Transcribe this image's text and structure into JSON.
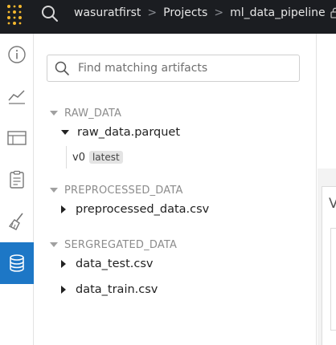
{
  "breadcrumb": {
    "user": "wasuratfirst",
    "section": "Projects",
    "project": "ml_data_pipeline",
    "separator": ">"
  },
  "sidebar": {
    "items": [
      {
        "icon": "info-icon"
      },
      {
        "icon": "line-chart-icon"
      },
      {
        "icon": "table-icon"
      },
      {
        "icon": "clipboard-icon"
      },
      {
        "icon": "broom-icon"
      },
      {
        "icon": "database-icon",
        "active": true
      }
    ]
  },
  "search": {
    "placeholder": "Find matching artifacts"
  },
  "artifact_groups": [
    {
      "name": "RAW_DATA",
      "expanded": true,
      "items": [
        {
          "name": "raw_data.parquet",
          "expanded": true,
          "versions": [
            {
              "version": "v0",
              "alias": "latest"
            }
          ]
        }
      ]
    },
    {
      "name": "PREPROCESSED_DATA",
      "expanded": true,
      "items": [
        {
          "name": "preprocessed_data.csv",
          "expanded": false
        }
      ]
    },
    {
      "name": "SERGREGATED_DATA",
      "expanded": true,
      "items": [
        {
          "name": "data_test.csv",
          "expanded": false
        },
        {
          "name": "data_train.csv",
          "expanded": false
        }
      ]
    }
  ],
  "right_panel": {
    "partial_letter": "V"
  },
  "colors": {
    "topbar": "#1b1d21",
    "active_nav": "#1d77c6",
    "logo_yellow": "#f5b82e"
  }
}
